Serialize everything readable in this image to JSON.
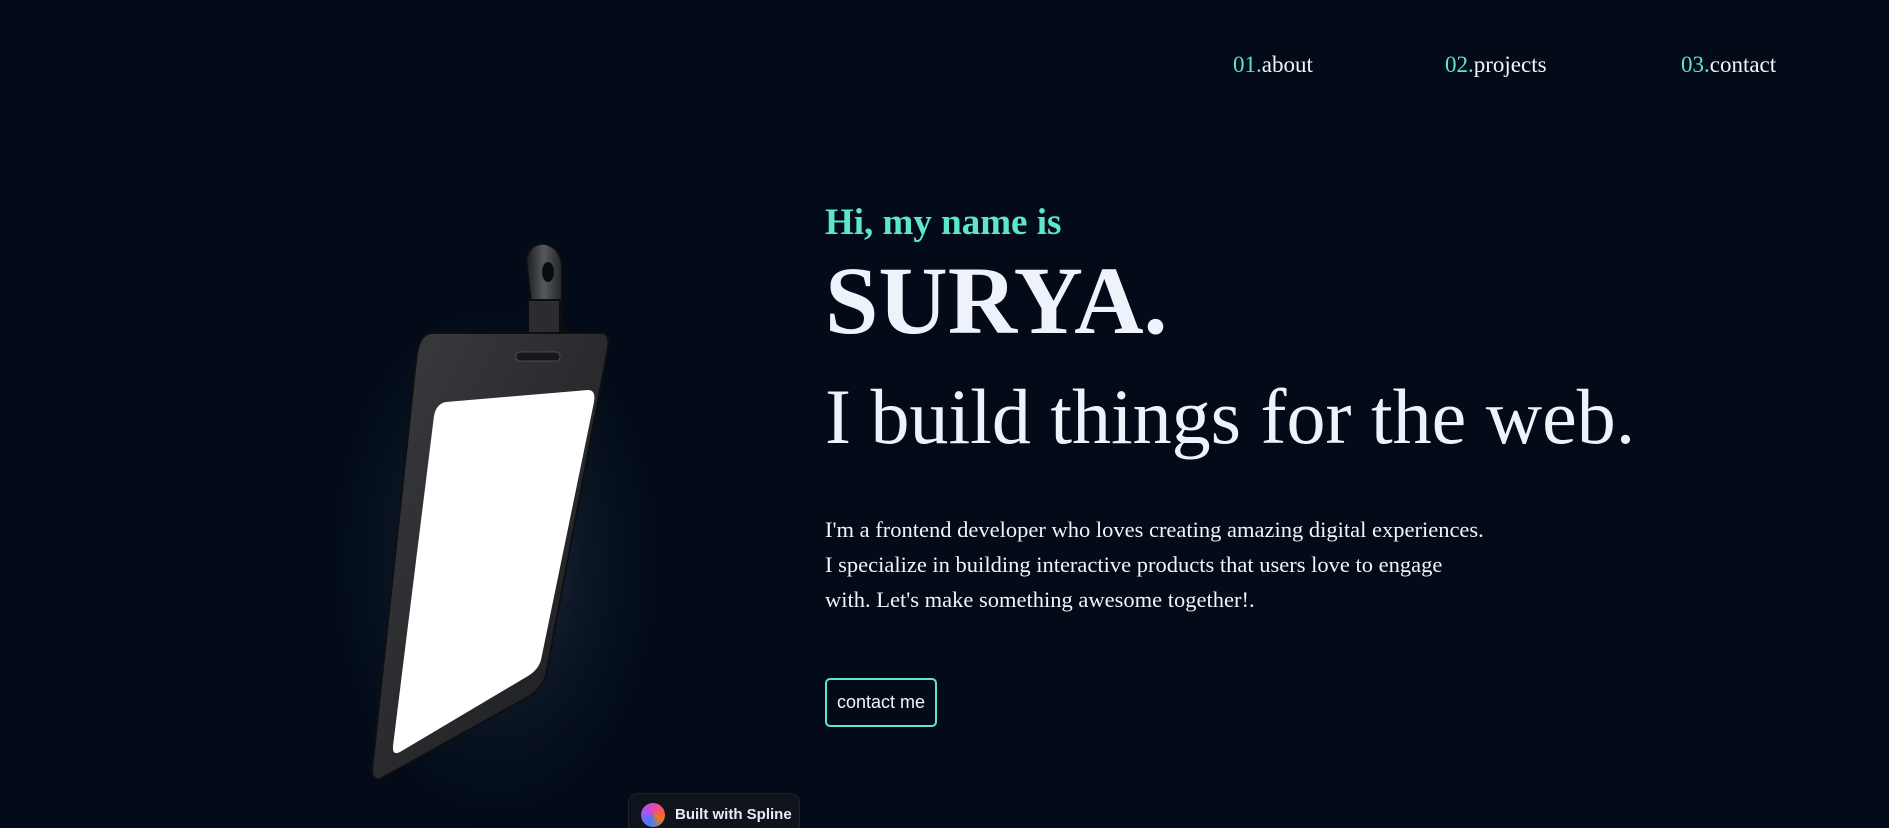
{
  "colors": {
    "background": "#030b18",
    "accent": "#5ee6c8",
    "text": "#eef3fb"
  },
  "nav": {
    "items": [
      {
        "number": "01.",
        "label": "about"
      },
      {
        "number": "02.",
        "label": "projects"
      },
      {
        "number": "03.",
        "label": "contact"
      }
    ]
  },
  "hero": {
    "greeting": "Hi, my name is",
    "name": "SURYA.",
    "tagline": "I build things for the web.",
    "intro_lines": [
      "I'm a frontend developer who loves creating amazing digital experiences.",
      "I specialize in building interactive products that users love to engage",
      "with. Let's make something awesome together!."
    ],
    "cta_label": "contact me"
  },
  "scene": {
    "object": "id-badge-3d",
    "icon": "badge-icon"
  },
  "spline_badge": {
    "label": "Built with Spline",
    "icon": "spline-logo-icon"
  }
}
